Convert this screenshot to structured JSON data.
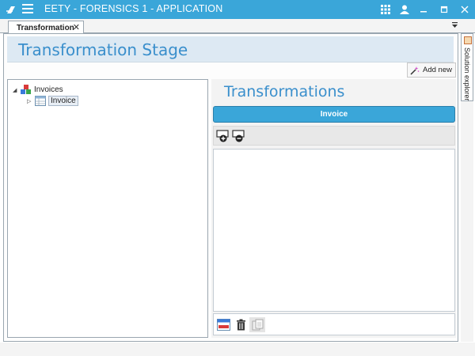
{
  "window": {
    "title": "EETY - FORENSICS 1 - APPLICATION",
    "accent_color": "#3aa6d9",
    "icons": [
      "app-logo-icon",
      "hamburger-menu-icon",
      "apps-grid-icon",
      "user-icon",
      "minimize-icon",
      "maximize-icon",
      "close-icon"
    ]
  },
  "tabs": [
    {
      "label": "Transformation",
      "close": "✕"
    }
  ],
  "stage": {
    "title": "Transformation Stage",
    "add_new_label": "Add new"
  },
  "tree": {
    "root": {
      "label": "Invoices",
      "expand_glyph": "◢"
    },
    "child": {
      "label": "Invoice",
      "expand_glyph": "▷"
    }
  },
  "transformations": {
    "title": "Transformations",
    "selected_item": "Invoice"
  },
  "sidebar": {
    "solution_explorer_label": "Solution explorer"
  }
}
